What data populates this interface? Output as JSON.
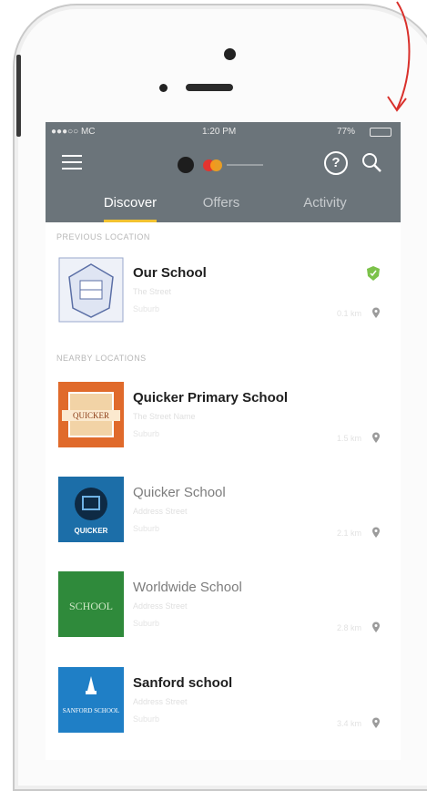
{
  "status_bar": {
    "carrier": "●●●○○ MC ",
    "time": "1:20 PM",
    "battery": "77%"
  },
  "toolbar": {
    "menu_icon": "hamburger-icon",
    "help_icon": "question-circle-icon",
    "search_icon": "magnifier-icon"
  },
  "tabs": [
    {
      "label": "Discover",
      "active": true
    },
    {
      "label": "Offers",
      "active": false
    },
    {
      "label": "Activity",
      "active": false
    }
  ],
  "sections": {
    "previous": "PREVIOUS LOCATION",
    "nearby": "NEARBY LOCATIONS"
  },
  "previous_location": {
    "name": "Our School",
    "line1": "The Street",
    "line2": "Suburb",
    "distance": "0.1 km",
    "checked_in": true
  },
  "nearby_locations": [
    {
      "name": "Quicker Primary School",
      "line1": "The Street Name",
      "line2": "Suburb",
      "distance": "1.5 km",
      "thumb_text": "QUICKER",
      "thumb_color": "#e06a2b"
    },
    {
      "name": "Quicker School",
      "line1": "Address Street",
      "line2": "Suburb",
      "distance": "2.1 km",
      "thumb_text": "QUICKER",
      "thumb_color": "#1c6ea8"
    },
    {
      "name": "Worldwide School",
      "line1": "Address Street",
      "line2": "Suburb",
      "distance": "2.8 km",
      "thumb_text": "SCHOOL",
      "thumb_color": "#2f8a3b"
    },
    {
      "name": "Sanford school",
      "line1": "Address Street",
      "line2": "Suburb",
      "distance": "3.4 km",
      "thumb_text": "SANFORD SCHOOL",
      "thumb_color": "#1f7fc6"
    }
  ],
  "colors": {
    "header": "#6b747a",
    "tab_underline": "#f2c230",
    "check_badge": "#7cc24a",
    "arrow": "#d9302b"
  }
}
